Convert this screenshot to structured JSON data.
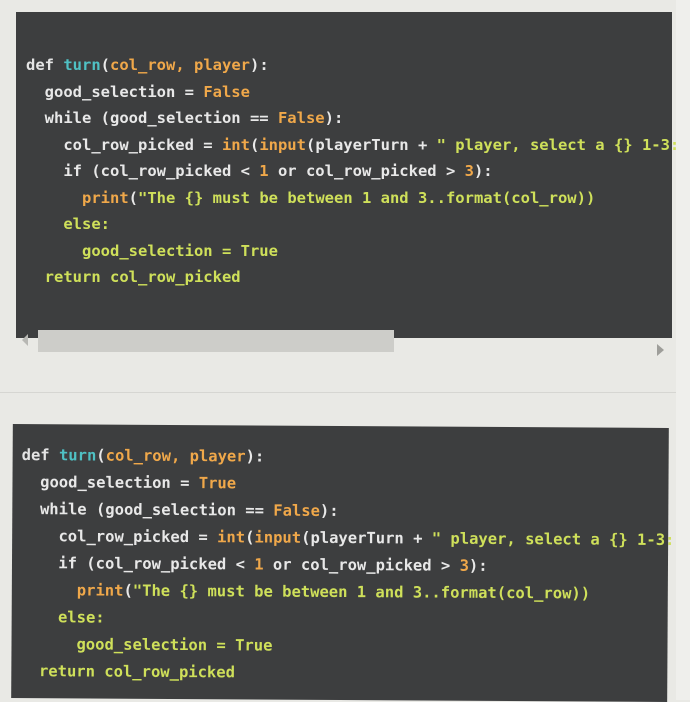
{
  "snippets": [
    {
      "lines": [
        [
          {
            "t": "def ",
            "c": "kw"
          },
          {
            "t": "turn",
            "c": "fn"
          },
          {
            "t": "(",
            "c": "plain"
          },
          {
            "t": "col_row, player",
            "c": "par"
          },
          {
            "t": "):",
            "c": "plain"
          }
        ],
        [
          {
            "t": "  good_selection = ",
            "c": "plain"
          },
          {
            "t": "False",
            "c": "bool"
          }
        ],
        [
          {
            "t": "  while (good_selection == ",
            "c": "plain"
          },
          {
            "t": "False",
            "c": "bool"
          },
          {
            "t": "):",
            "c": "plain"
          }
        ],
        [
          {
            "t": "    col_row_picked = ",
            "c": "plain"
          },
          {
            "t": "int",
            "c": "bi"
          },
          {
            "t": "(",
            "c": "plain"
          },
          {
            "t": "input",
            "c": "bi"
          },
          {
            "t": "(playerTurn + ",
            "c": "plain"
          },
          {
            "t": "\" player, select a {} 1-3:",
            "c": "str"
          }
        ],
        [
          {
            "t": "    if (col_row_picked < ",
            "c": "plain"
          },
          {
            "t": "1",
            "c": "num"
          },
          {
            "t": " or col_row_picked > ",
            "c": "plain"
          },
          {
            "t": "3",
            "c": "num"
          },
          {
            "t": "):",
            "c": "plain"
          }
        ],
        [
          {
            "t": "      ",
            "c": "plain"
          },
          {
            "t": "print",
            "c": "bi"
          },
          {
            "t": "(",
            "c": "plain"
          },
          {
            "t": "\"The {} must be between 1 and 3..format(col_row))",
            "c": "str"
          }
        ],
        [
          {
            "t": "    else:",
            "c": "green"
          }
        ],
        [
          {
            "t": "      good_selection = True",
            "c": "green"
          }
        ],
        [
          {
            "t": "  return col_row_picked",
            "c": "green"
          }
        ]
      ]
    },
    {
      "lines": [
        [
          {
            "t": "def ",
            "c": "kw"
          },
          {
            "t": "turn",
            "c": "fn"
          },
          {
            "t": "(",
            "c": "plain"
          },
          {
            "t": "col_row, player",
            "c": "par"
          },
          {
            "t": "):",
            "c": "plain"
          }
        ],
        [
          {
            "t": "  good_selection = ",
            "c": "plain"
          },
          {
            "t": "True",
            "c": "bool"
          }
        ],
        [
          {
            "t": "  while (good_selection == ",
            "c": "plain"
          },
          {
            "t": "False",
            "c": "bool"
          },
          {
            "t": "):",
            "c": "plain"
          }
        ],
        [
          {
            "t": "    col_row_picked = ",
            "c": "plain"
          },
          {
            "t": "int",
            "c": "bi"
          },
          {
            "t": "(",
            "c": "plain"
          },
          {
            "t": "input",
            "c": "bi"
          },
          {
            "t": "(playerTurn + ",
            "c": "plain"
          },
          {
            "t": "\" player, select a {} 1-3:",
            "c": "str"
          }
        ],
        [
          {
            "t": "    if (col_row_picked < ",
            "c": "plain"
          },
          {
            "t": "1",
            "c": "num"
          },
          {
            "t": " or col_row_picked > ",
            "c": "plain"
          },
          {
            "t": "3",
            "c": "num"
          },
          {
            "t": "):",
            "c": "plain"
          }
        ],
        [
          {
            "t": "      ",
            "c": "plain"
          },
          {
            "t": "print",
            "c": "bi"
          },
          {
            "t": "(",
            "c": "plain"
          },
          {
            "t": "\"The {} must be between 1 and 3..format(col_row))",
            "c": "str"
          }
        ],
        [
          {
            "t": "    else:",
            "c": "green"
          }
        ],
        [
          {
            "t": "      good_selection = True",
            "c": "green"
          }
        ],
        [
          {
            "t": "  return col_row_picked",
            "c": "green"
          }
        ]
      ]
    }
  ],
  "scrollbar": {
    "left_arrow_icon": "triangle-left-icon",
    "right_arrow_icon": "triangle-right-icon",
    "thumb_fraction": 0.55
  },
  "colors": {
    "panel_bg": "#3d3e3f",
    "function_name": "#4fc1c4",
    "keyword_orange": "#f0a84a",
    "string_green": "#cfe05a"
  }
}
